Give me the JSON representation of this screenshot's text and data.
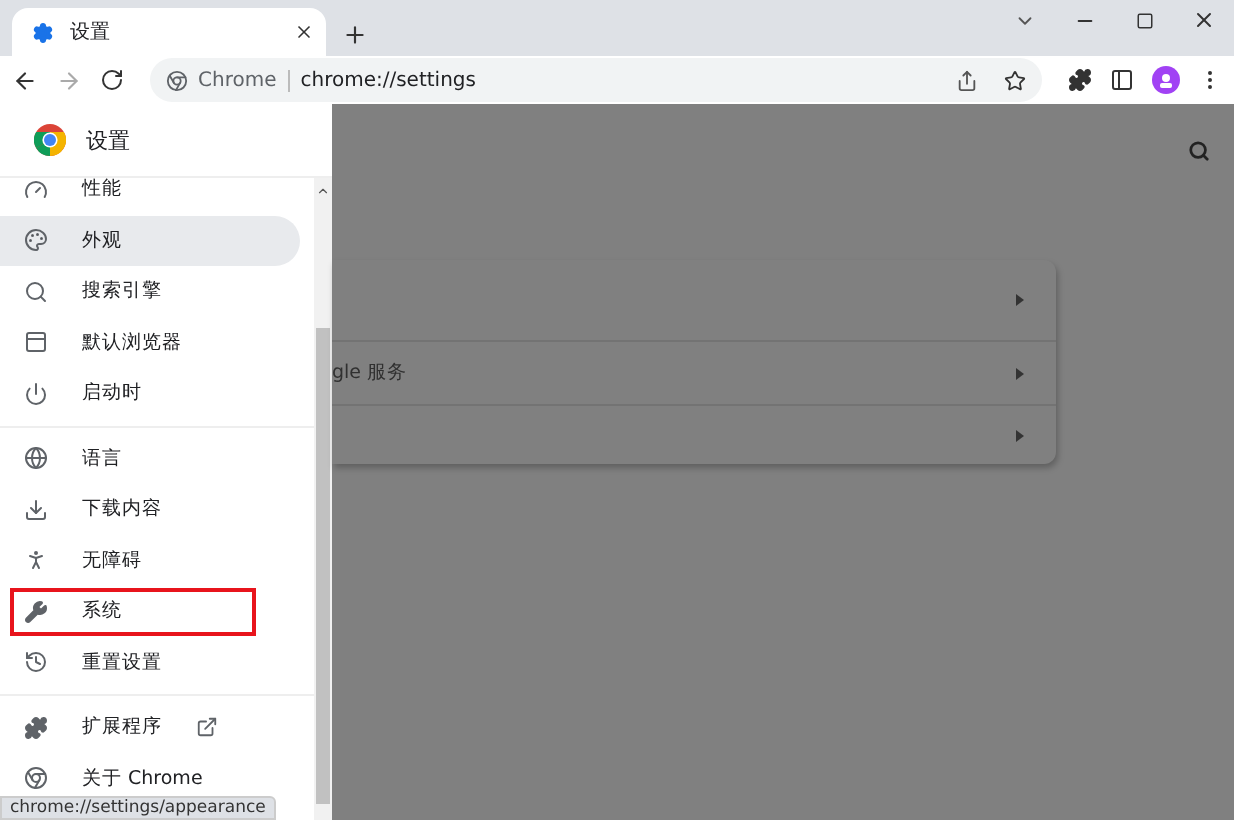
{
  "tab": {
    "title": "设置"
  },
  "omnibox": {
    "chip": "Chrome",
    "url": "chrome://settings"
  },
  "drawer": {
    "title": "设置",
    "sections": [
      {
        "items": [
          {
            "label": "性能",
            "selected": false,
            "highlighted": false
          },
          {
            "label": "外观",
            "selected": true,
            "highlighted": false
          },
          {
            "label": "搜索引擎",
            "selected": false,
            "highlighted": false
          },
          {
            "label": "默认浏览器",
            "selected": false,
            "highlighted": false
          },
          {
            "label": "启动时",
            "selected": false,
            "highlighted": false
          }
        ]
      },
      {
        "items": [
          {
            "label": "语言",
            "selected": false,
            "highlighted": false
          },
          {
            "label": "下载内容",
            "selected": false,
            "highlighted": false
          },
          {
            "label": "无障碍",
            "selected": false,
            "highlighted": false
          },
          {
            "label": "系统",
            "selected": false,
            "highlighted": true
          },
          {
            "label": "重置设置",
            "selected": false,
            "highlighted": false
          }
        ]
      },
      {
        "items": [
          {
            "label": "扩展程序",
            "selected": false,
            "highlighted": false,
            "external": true
          },
          {
            "label": "关于 Chrome",
            "selected": false,
            "highlighted": false,
            "external": false
          }
        ]
      }
    ]
  },
  "card": {
    "middle_row_text": "gle 服务"
  },
  "status_bubble": "chrome://settings/appearance"
}
